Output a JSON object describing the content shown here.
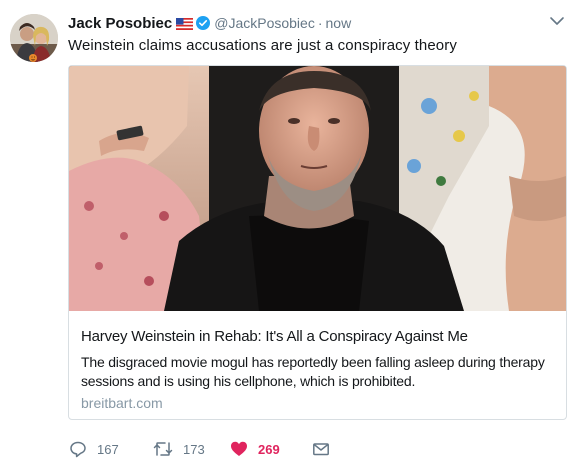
{
  "tweet": {
    "author_name": "Jack Posobiec",
    "handle": "@JackPosobiec",
    "separator": "·",
    "time": "now",
    "text": "Weinstein claims accusations are just a conspiracy theory"
  },
  "card": {
    "title": "Harvey Weinstein in Rehab: It's All a Conspiracy Against Me",
    "description": "The disgraced movie mogul has reportedly been falling asleep during therapy sessions and is using his cellphone, which is prohibited.",
    "domain": "breitbart.com"
  },
  "actions": {
    "reply_count": "167",
    "retweet_count": "173",
    "like_count": "269"
  },
  "icons": {
    "flag": "us-flag-icon",
    "verified": "verified-badge-icon",
    "caret": "chevron-down-icon",
    "reply": "reply-icon",
    "retweet": "retweet-icon",
    "like": "heart-icon",
    "dm": "envelope-icon"
  },
  "colors": {
    "verified": "#1da1f2",
    "like": "#e0245e",
    "muted": "#657786",
    "domain": "#8899a6"
  }
}
